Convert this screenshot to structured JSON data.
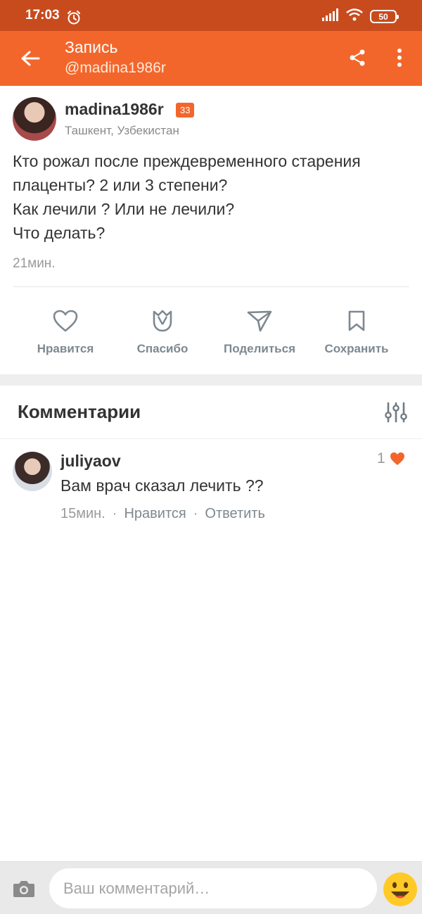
{
  "status_bar": {
    "time": "17:03",
    "battery": "50"
  },
  "app_bar": {
    "title": "Запись",
    "subtitle": "@madina1986r"
  },
  "post": {
    "author": "madina1986r",
    "level": "33",
    "location": "Ташкент, Узбекистан",
    "text_lines": [
      "Кто рожал после преждевременного старения",
      "плаценты? 2 или 3 степени?",
      "Как лечили ? Или не лечили?",
      "Что делать?"
    ],
    "time": "21мин."
  },
  "actions": {
    "like": "Нравится",
    "thanks": "Спасибо",
    "share": "Поделиться",
    "save": "Сохранить"
  },
  "comments_section": {
    "title": "Комментарии"
  },
  "comments": [
    {
      "author": "juliyaov",
      "text": "Вам врач сказал лечить ??",
      "time": "15мин.",
      "like_label": "Нравится",
      "reply_label": "Ответить",
      "likes": "1"
    }
  ],
  "input": {
    "placeholder": "Ваш комментарий…"
  },
  "colors": {
    "brand": "#f3662b",
    "status_bar": "#c84b1e",
    "action_gray": "#7d8890"
  },
  "icons": [
    "back-arrow-icon",
    "share-icon",
    "more-vertical-icon",
    "heart-icon",
    "tulip-icon",
    "send-icon",
    "bookmark-icon",
    "filter-icon",
    "camera-icon",
    "emoji-icon",
    "alarm-icon",
    "signal-icon",
    "wifi-icon"
  ]
}
